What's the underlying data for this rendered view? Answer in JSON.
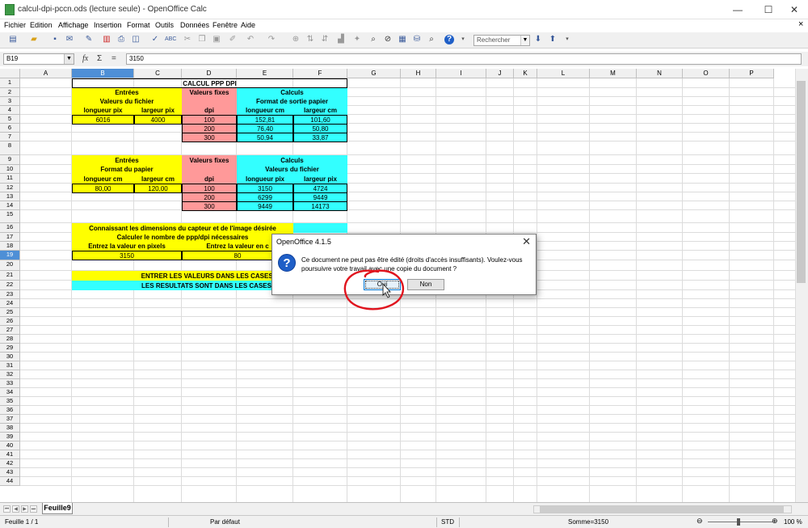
{
  "window": {
    "title": "calcul-dpi-pccn.ods (lecture seule) - OpenOffice Calc",
    "min": "—",
    "max": "☐",
    "close": "✕"
  },
  "menu": [
    "Fichier",
    "Edition",
    "Affichage",
    "Insertion",
    "Format",
    "Outils",
    "Données",
    "Fenêtre",
    "Aide"
  ],
  "toolbar": {
    "search_placeholder": "Rechercher"
  },
  "formula": {
    "cell_ref": "B19",
    "value": "3150",
    "fx": "fx",
    "sum": "Σ",
    "eq": "="
  },
  "columns": [
    "A",
    "B",
    "C",
    "D",
    "E",
    "F",
    "G",
    "H",
    "I",
    "J",
    "K",
    "L",
    "M",
    "N",
    "O",
    "P"
  ],
  "selected_column": "B",
  "rows": [
    "1",
    "2",
    "3",
    "4",
    "5",
    "6",
    "7",
    "8",
    "9",
    "10",
    "11",
    "12",
    "13",
    "14",
    "15",
    "16",
    "17",
    "18",
    "19",
    "20",
    "21",
    "22",
    "23",
    "24",
    "25",
    "26",
    "27",
    "28",
    "29",
    "30",
    "31",
    "32",
    "33",
    "34",
    "35",
    "36",
    "37",
    "38",
    "39",
    "40",
    "41",
    "42",
    "43",
    "44"
  ],
  "selected_row": "19",
  "cells": {
    "title": "CALCUL PPP DPI",
    "t1": {
      "entrees": "Entrées",
      "valeurs_fichier": "Valeurs du fichier",
      "longueur_pix": "longueur pix",
      "largeur_pix": "largeur pix",
      "in_long": "6016",
      "in_larg": "4000",
      "valeurs_fixes": "Valeurs fixes",
      "dpi": "dpi",
      "dpi_values": [
        "100",
        "200",
        "300"
      ],
      "calculs": "Calculs",
      "format_sortie": "Format de sortie papier",
      "longueur_cm": "longueur cm",
      "largeur_cm": "largeur cm",
      "out": [
        [
          "152,81",
          "101,60"
        ],
        [
          "76,40",
          "50,80"
        ],
        [
          "50,94",
          "33,87"
        ]
      ]
    },
    "t2": {
      "entrees": "Entrées",
      "format_papier": "Format du papier",
      "longueur_cm": "longueur cm",
      "largeur_cm": "largeur cm",
      "in_long": "80,00",
      "in_larg": "120,00",
      "valeurs_fixes": "Valeurs fixes",
      "dpi": "dpi",
      "dpi_values": [
        "100",
        "200",
        "300"
      ],
      "calculs": "Calculs",
      "valeurs_fichier": "Valeurs du fichier",
      "longueur_pix": "longueur pix",
      "largeur_pix": "largeur pix",
      "out": [
        [
          "3150",
          "4724"
        ],
        [
          "6299",
          "9449"
        ],
        [
          "9449",
          "14173"
        ]
      ]
    },
    "t3": {
      "r16": "Connaissant les dimensions du capteur et de l'image désirée",
      "r17": "Calculer le nombre de ppp/dpi nécessaires",
      "r18a": "Entrez la valeur en pixels",
      "r18b": "Entrez la valeur en c",
      "r19a": "3150",
      "r19b": "80"
    },
    "r21": "ENTRER LES VALEURS DANS LES CASES J",
    "r22": "LES RESULTATS SONT DANS LES CASES B"
  },
  "sheet_tab": "Feuille9",
  "status": {
    "sheet": "Feuille 1 / 1",
    "style": "Par défaut",
    "mode": "STD",
    "sum": "Somme=3150",
    "zoom": "100 %"
  },
  "dialog": {
    "title": "OpenOffice 4.1.5",
    "message": "Ce document ne peut pas être édité (droits d'accès insuffisants). Voulez-vous poursuivre votre travail avec une copie du document ?",
    "yes": "Oui",
    "no": "Non"
  },
  "colors": {
    "yellow": "#ffff00",
    "cyan": "#33ffff",
    "pink": "#ff9999",
    "selection": "#4e8fd6",
    "annotation": "#e0141e"
  }
}
